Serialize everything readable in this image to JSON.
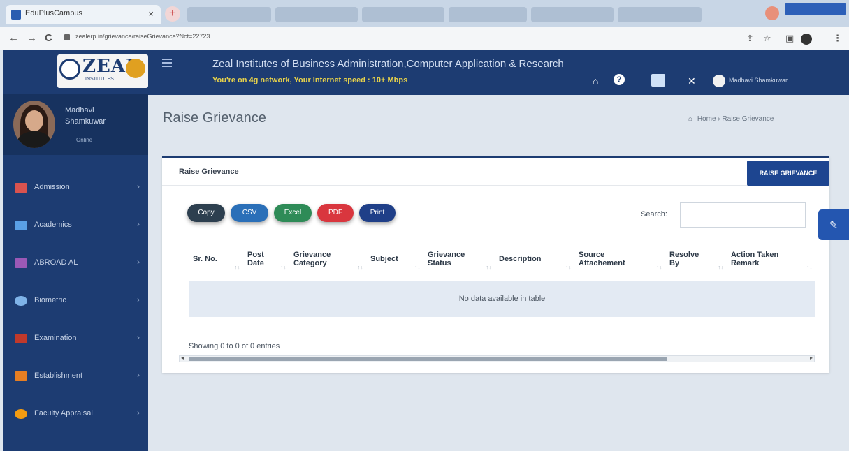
{
  "browser": {
    "active_tab_title": "EduPlusCampus",
    "tab_close": "×",
    "new_tab": "+",
    "url": "zealerp.in/grievance/raiseGrievance?Nct=22723",
    "nav": {
      "back": "←",
      "forward": "→",
      "reload": "C"
    },
    "menu_glyph": "⋮"
  },
  "sidebar": {
    "logo_text": "ZEAL",
    "logo_sub": "INSTITUTES",
    "profile": {
      "first_name": "Madhavi",
      "last_name": "Shamkuwar",
      "status": "Online"
    },
    "items": [
      {
        "label": "Admission",
        "icon": "id-card-icon",
        "color": "#d9534f"
      },
      {
        "label": "Academics",
        "icon": "chart-line-icon",
        "color": "#5aa0e6"
      },
      {
        "label": "ABROAD AL",
        "icon": "document-icon",
        "color": "#9b59b6"
      },
      {
        "label": "Biometric",
        "icon": "fingerprint-icon",
        "color": "#7fb3e8"
      },
      {
        "label": "Examination",
        "icon": "building-columns-icon",
        "color": "#c0392b"
      },
      {
        "label": "Establishment",
        "icon": "users-icon",
        "color": "#e67e22"
      },
      {
        "label": "Faculty Appraisal",
        "icon": "comment-icon",
        "color": "#f39c12"
      }
    ]
  },
  "header": {
    "institute_title": "Zeal Institutes of Business Administration,Computer Application & Research",
    "network_status": "You're on 4g network, Your Internet speed : 10+ Mbps",
    "user_name": "Madhavi Shamkuwar"
  },
  "page": {
    "title": "Raise Grievance",
    "breadcrumb_home": "Home",
    "breadcrumb_current": "Raise Grievance"
  },
  "card": {
    "title": "Raise Grievance",
    "raise_button": "RAISE GRIEVANCE",
    "export_buttons": [
      {
        "label": "Copy",
        "color": "#2d3f4f"
      },
      {
        "label": "CSV",
        "color": "#2a6fb8"
      },
      {
        "label": "Excel",
        "color": "#2e8b57"
      },
      {
        "label": "PDF",
        "color": "#d9363e"
      },
      {
        "label": "Print",
        "color": "#1f3f88"
      }
    ],
    "search_label": "Search:",
    "search_value": "",
    "columns": [
      {
        "line1": "Sr. No.",
        "line2": ""
      },
      {
        "line1": "Post",
        "line2": "Date"
      },
      {
        "line1": "Grievance",
        "line2": "Category"
      },
      {
        "line1": "Subject",
        "line2": ""
      },
      {
        "line1": "Grievance",
        "line2": "Status"
      },
      {
        "line1": "Description",
        "line2": ""
      },
      {
        "line1": "Source",
        "line2": "Attachement"
      },
      {
        "line1": "Resolve",
        "line2": "By"
      },
      {
        "line1": "Action Taken",
        "line2": "Remark"
      }
    ],
    "sort_glyph": "↑↓",
    "empty_message": "No data available in table",
    "info_text": "Showing 0 to 0 of 0 entries"
  },
  "accent_color": "#1d3c72"
}
